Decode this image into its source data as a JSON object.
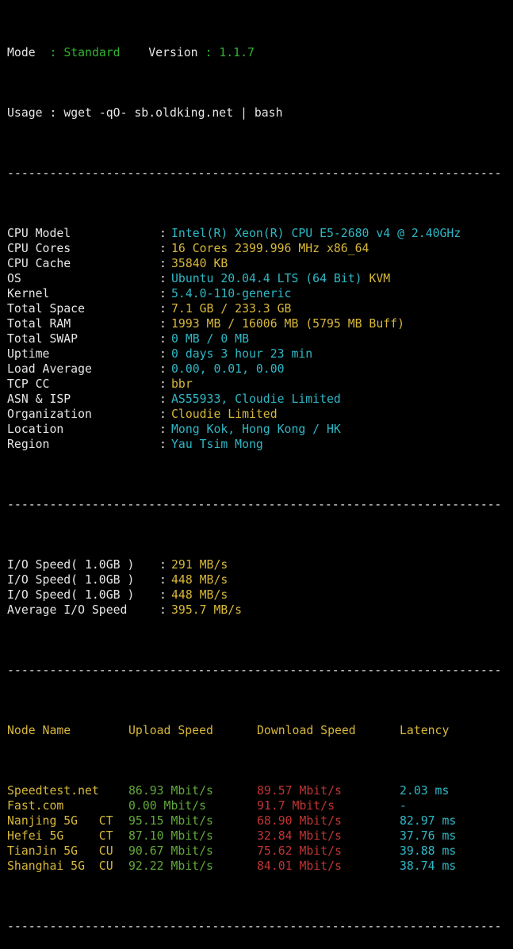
{
  "header": {
    "mode_label": "Mode",
    "mode_sep": ":",
    "mode_value": "Standard",
    "version_label": "Version",
    "version_sep": ":",
    "version_value": "1.1.7",
    "usage_label": "Usage",
    "usage_sep": ":",
    "usage_value": "wget -qO- sb.oldking.net | bash"
  },
  "divider": "----------------------------------------------------------------------",
  "sysinfo": [
    {
      "label": "CPU Model",
      "value": "Intel(R) Xeon(R) CPU E5-2680 v4 @ 2.40GHz",
      "extra": "",
      "color": "c"
    },
    {
      "label": "CPU Cores",
      "value": "16 Cores 2399.996 MHz x86_64",
      "extra": "",
      "color": "y"
    },
    {
      "label": "CPU Cache",
      "value": "35840 KB",
      "extra": "",
      "color": "y"
    },
    {
      "label": "OS",
      "value": "Ubuntu 20.04.4 LTS (64 Bit)",
      "extra": "KVM",
      "color": "c"
    },
    {
      "label": "Kernel",
      "value": "5.4.0-110-generic",
      "extra": "",
      "color": "c"
    },
    {
      "label": "Total Space",
      "value": "7.1 GB / 233.3 GB",
      "extra": "",
      "color": "y"
    },
    {
      "label": "Total RAM",
      "value": "1993 MB / 16006 MB (5795 MB Buff)",
      "extra": "",
      "color": "y"
    },
    {
      "label": "Total SWAP",
      "value": "0 MB / 0 MB",
      "extra": "",
      "color": "c"
    },
    {
      "label": "Uptime",
      "value": "0 days 3 hour 23 min",
      "extra": "",
      "color": "c"
    },
    {
      "label": "Load Average",
      "value": "0.00, 0.01, 0.00",
      "extra": "",
      "color": "c"
    },
    {
      "label": "TCP CC",
      "value": "bbr",
      "extra": "",
      "color": "y"
    },
    {
      "label": "ASN & ISP",
      "value": "AS55933, Cloudie Limited",
      "extra": "",
      "color": "c"
    },
    {
      "label": "Organization",
      "value": "Cloudie Limited",
      "extra": "",
      "color": "y"
    },
    {
      "label": "Location",
      "value": "Mong Kok, Hong Kong / HK",
      "extra": "",
      "color": "c"
    },
    {
      "label": "Region",
      "value": "Yau Tsim Mong",
      "extra": "",
      "color": "c"
    }
  ],
  "io": [
    {
      "label": "I/O Speed( 1.0GB )",
      "value": "291 MB/s",
      "color": "y"
    },
    {
      "label": "I/O Speed( 1.0GB )",
      "value": "448 MB/s",
      "color": "y"
    },
    {
      "label": "I/O Speed( 1.0GB )",
      "value": "448 MB/s",
      "color": "y"
    },
    {
      "label": "Average I/O Speed",
      "value": "395.7 MB/s",
      "color": "y"
    }
  ],
  "speedtest": {
    "headers": [
      "Node Name",
      "Upload Speed",
      "Download Speed",
      "Latency"
    ],
    "rows": [
      {
        "node": "Speedtest.net",
        "up": "86.93 Mbit/s",
        "down": "89.57 Mbit/s",
        "lat": "2.03 ms"
      },
      {
        "node": "Fast.com",
        "up": "0.00 Mbit/s",
        "down": "91.7 Mbit/s",
        "lat": "-"
      },
      {
        "node": "Nanjing 5G   CT",
        "up": "95.15 Mbit/s",
        "down": "68.90 Mbit/s",
        "lat": "82.97 ms"
      },
      {
        "node": "Hefei 5G     CT",
        "up": "87.10 Mbit/s",
        "down": "32.84 Mbit/s",
        "lat": "37.76 ms"
      },
      {
        "node": "TianJin 5G   CU",
        "up": "90.67 Mbit/s",
        "down": "75.62 Mbit/s",
        "lat": "39.88 ms"
      },
      {
        "node": "Shanghai 5G  CU",
        "up": "92.22 Mbit/s",
        "down": "84.01 Mbit/s",
        "lat": "38.74 ms"
      }
    ]
  },
  "colors": {
    "background": "#000000",
    "white": "#e6e6e6",
    "green": "#2fb32f",
    "cyan": "#2fb8c6",
    "yellow": "#d7b83a",
    "red": "#d03a3a"
  }
}
